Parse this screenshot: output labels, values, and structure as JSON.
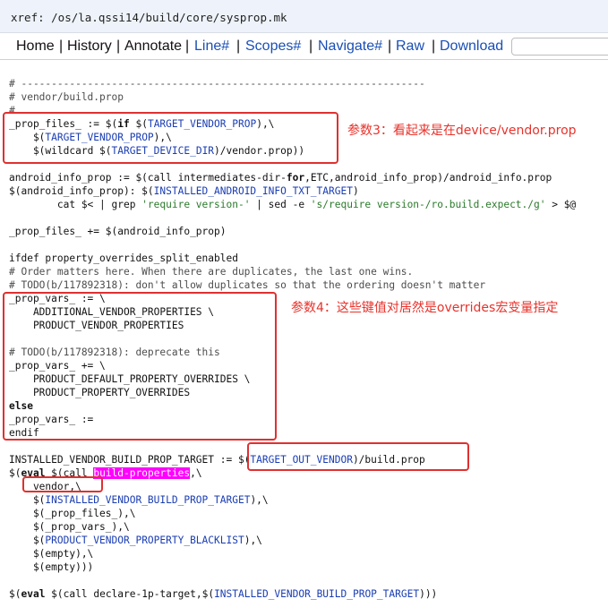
{
  "xref": "xref: /os/la.qssi14/build/core/sysprop.mk",
  "nav": {
    "home": "Home",
    "history": "History",
    "annotate": "Annotate",
    "line": "Line#",
    "scopes": "Scopes#",
    "navigate": "Navigate#",
    "raw": "Raw",
    "download": "Download",
    "sep": "|"
  },
  "search": {
    "placeholder": ""
  },
  "annotations": {
    "param3": "参数3：看起来是在device/vendor.prop",
    "param4": "参数4：这些键值对居然是overrides宏变量指定"
  },
  "code": {
    "l01": "# -------------------------------------------------------------------",
    "l02": "# vendor/build.prop",
    "l03": "#",
    "l04a": "_prop_files_ := $(",
    "l04b": "if",
    "l04c": " $(",
    "l04d": "TARGET_VENDOR_PROP",
    "l04e": "),\\",
    "l05a": "    $(",
    "l05b": "TARGET_VENDOR_PROP",
    "l05c": "),\\",
    "l06a": "    $(",
    "l06b": "wildcard",
    "l06c": " $(",
    "l06d": "TARGET_DEVICE_DIR",
    "l06e": ")/vendor.prop))",
    "l07a": "android_info_prop := $(",
    "l07b": "call",
    "l07c": " intermediates-dir-",
    "l07d": "for",
    "l07e": ",ETC,android_info_prop)/android_info.prop",
    "l08a": "$(android_info_prop): $(",
    "l08b": "INSTALLED_ANDROID_INFO_TXT_TARGET",
    "l08c": ")",
    "l09a": "        cat $< | grep ",
    "l09b": "'require version-'",
    "l09c": " | sed -e ",
    "l09d": "'s/require version-/ro.build.expect./g'",
    "l09e": " > $@",
    "l10": "_prop_files_ += $(android_info_prop)",
    "l11": "ifdef property_overrides_split_enabled",
    "l12": "# Order matters here. When there are duplicates, the last one wins.",
    "l13": "# TODO(b/117892318): don't allow duplicates so that the ordering doesn't matter",
    "l14": "_prop_vars_ := \\",
    "l15": "    ADDITIONAL_VENDOR_PROPERTIES \\",
    "l16": "    PRODUCT_VENDOR_PROPERTIES",
    "l17": "# TODO(b/117892318): deprecate this",
    "l18": "_prop_vars_ += \\",
    "l19": "    PRODUCT_DEFAULT_PROPERTY_OVERRIDES \\",
    "l20": "    PRODUCT_PROPERTY_OVERRIDES",
    "l21": "else",
    "l22": "_prop_vars_ :=",
    "l23": "endif",
    "l24a": "INSTALLED_VENDOR_BUILD_PROP_TARGET := $(",
    "l24b": "TARGET_OUT_VENDOR",
    "l24c": ")/build.prop",
    "l25a": "$(",
    "l25b": "eval",
    "l25c": " $(",
    "l25d": "call",
    "l25e": " ",
    "l25f": "build-properties",
    "l25g": ",\\",
    "l26": "    vendor,\\",
    "l27a": "    $(",
    "l27b": "INSTALLED_VENDOR_BUILD_PROP_TARGET",
    "l27c": "),\\",
    "l28": "    $(_prop_files_),\\",
    "l29": "    $(_prop_vars_),\\",
    "l30a": "    $(",
    "l30b": "PRODUCT_VENDOR_PROPERTY_BLACKLIST",
    "l30c": "),\\",
    "l31": "    $(empty),\\",
    "l32": "    $(empty)))",
    "l33a": "$(",
    "l33b": "eval",
    "l33c": " $(",
    "l33d": "call",
    "l33e": " declare-1p-target,$(",
    "l33f": "INSTALLED_VENDOR_BUILD_PROP_TARGET",
    "l33g": ")))"
  },
  "colors": {
    "annotation_red": "#e8322b",
    "highlight_magenta": "#ff00ff",
    "link_blue": "#1a4fb4"
  }
}
